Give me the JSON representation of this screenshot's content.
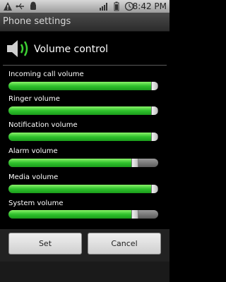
{
  "status_bar": {
    "time": "8:42 PM",
    "icons": [
      "warning-icon",
      "usb-icon",
      "android-icon",
      "signal-icon",
      "battery-icon",
      "alarm-icon"
    ]
  },
  "title_bar": {
    "title": "Phone settings"
  },
  "dialog": {
    "title": "Volume control",
    "icon": "speaker-icon",
    "sliders": [
      {
        "label": "Incoming call volume",
        "level": 1.0
      },
      {
        "label": "Ringer volume",
        "level": 1.0
      },
      {
        "label": "Notification volume",
        "level": 1.0
      },
      {
        "label": "Alarm volume",
        "level": 0.86
      },
      {
        "label": "Media volume",
        "level": 1.0
      },
      {
        "label": "System volume",
        "level": 0.86
      }
    ],
    "buttons": {
      "set": "Set",
      "cancel": "Cancel"
    }
  },
  "colors": {
    "accent_green": "#3dcf33",
    "track_gray": "#7a7a7a"
  }
}
